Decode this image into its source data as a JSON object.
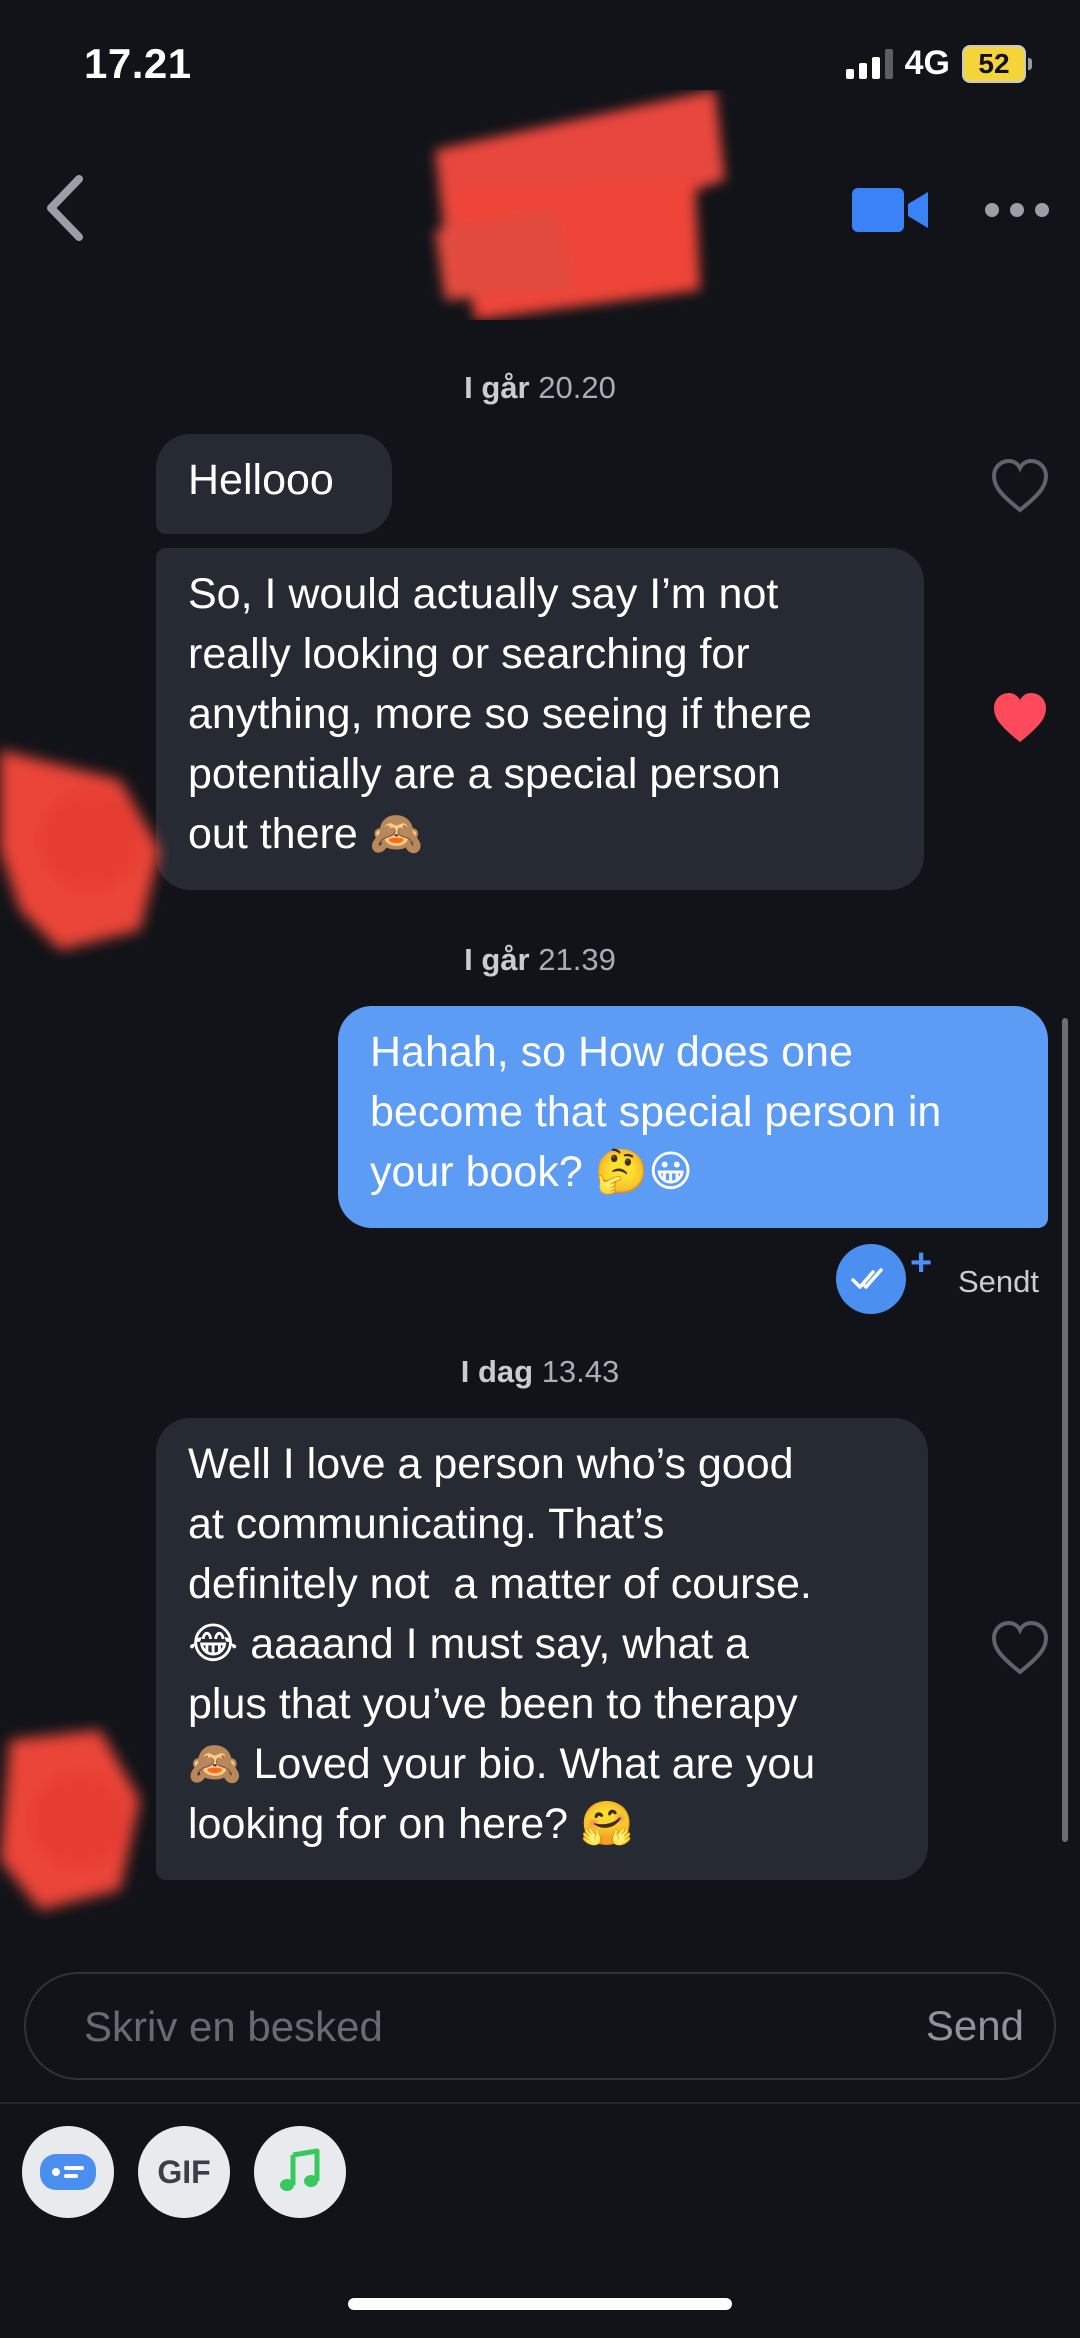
{
  "status_bar": {
    "time": "17.21",
    "network": "4G",
    "battery": "52"
  },
  "header": {
    "back_icon": "chevron-left-icon",
    "video_icon": "video-camera-icon",
    "more_icon": "more-dots-icon"
  },
  "messages": [
    {
      "timestamp_day": "I går",
      "timestamp_time": "20.20"
    },
    {
      "direction": "incoming",
      "text": "Hellooo",
      "liked": false
    },
    {
      "direction": "incoming",
      "text": "So, I would actually say I’m not\nreally looking or searching for\nanything, more so seeing if there\npotentially are a special person\nout there 🙈",
      "liked": true
    },
    {
      "timestamp_day": "I går",
      "timestamp_time": "21.39"
    },
    {
      "direction": "outgoing",
      "text": "Hahah, so How does one\nbecome that special person in\nyour book? 🤔😀"
    },
    {
      "timestamp_day": "I dag",
      "timestamp_time": "13.43"
    },
    {
      "direction": "incoming",
      "text": "Well I love a person who’s good\nat communicating. That’s\ndefinitely not  a matter of course.\n😂 aaaand I must say, what a\nplus that you’ve been to therapy\n🙈 Loved your bio. What are you\nlooking for on here? 🤗",
      "liked": false
    }
  ],
  "sent_status": "Sendt",
  "composer": {
    "placeholder": "Skriv en besked",
    "send_label": "Send"
  },
  "toolbar": {
    "gif_label": "GIF"
  },
  "colors": {
    "background": "#111318",
    "incoming_bubble": "#262a33",
    "outgoing_bubble": "#5d9cf5",
    "heart_active": "#fd4a5c",
    "accent_blue": "#4b8ff0"
  }
}
